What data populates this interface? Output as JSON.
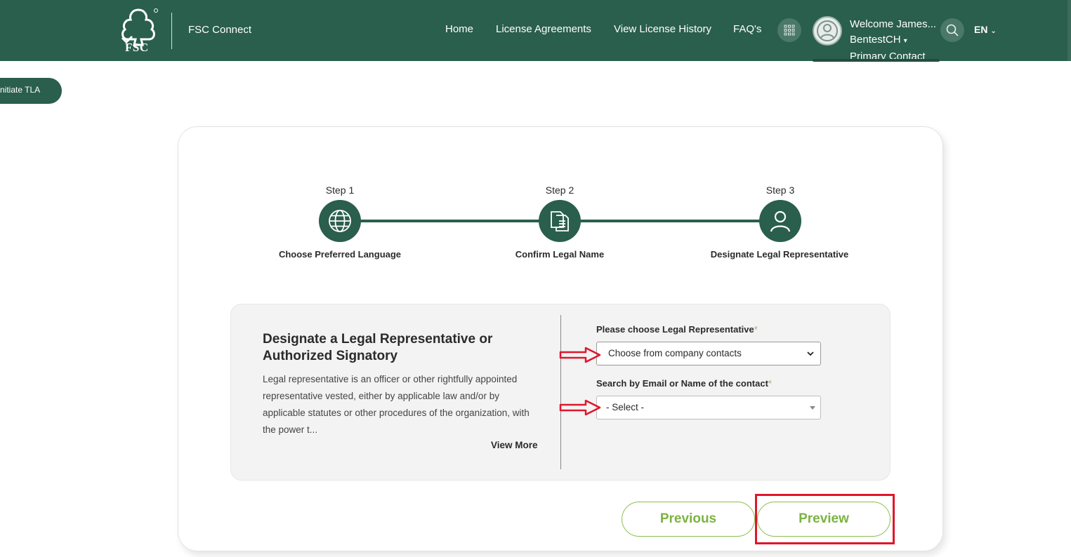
{
  "header": {
    "logo_text": "FSC",
    "app_name": "FSC Connect",
    "nav": [
      "Home",
      "License Agreements",
      "View License History",
      "FAQ's"
    ],
    "user": {
      "welcome": "Welcome James...",
      "org": "BentestCH",
      "role": "Primary Contact"
    },
    "language": "EN"
  },
  "initiate_button": "nitiate TLA",
  "stepper": {
    "steps": [
      {
        "title": "Step 1",
        "label": "Choose Preferred Language",
        "icon": "globe-icon"
      },
      {
        "title": "Step 2",
        "label": "Confirm Legal Name",
        "icon": "document-icon"
      },
      {
        "title": "Step 3",
        "label": "Designate Legal Representative",
        "icon": "person-icon"
      }
    ]
  },
  "panel": {
    "heading": "Designate a Legal Representative or Authorized Signatory",
    "description": "Legal representative is an officer or other rightfully appointed representative vested, either by applicable law and/or by applicable statutes or other procedures of the organization, with the power t...",
    "view_more": "View More",
    "field1": {
      "label": "Please choose Legal Representative",
      "required_mark": "*",
      "value": "Choose from company contacts"
    },
    "field2": {
      "label": "Search by Email or Name of the contact",
      "required_mark": "*",
      "value": "- Select -"
    }
  },
  "buttons": {
    "previous": "Previous",
    "preview": "Preview"
  },
  "colors": {
    "brand_green": "#2a5e4d",
    "accent_green": "#7cb342",
    "highlight_red": "#e0162b"
  }
}
